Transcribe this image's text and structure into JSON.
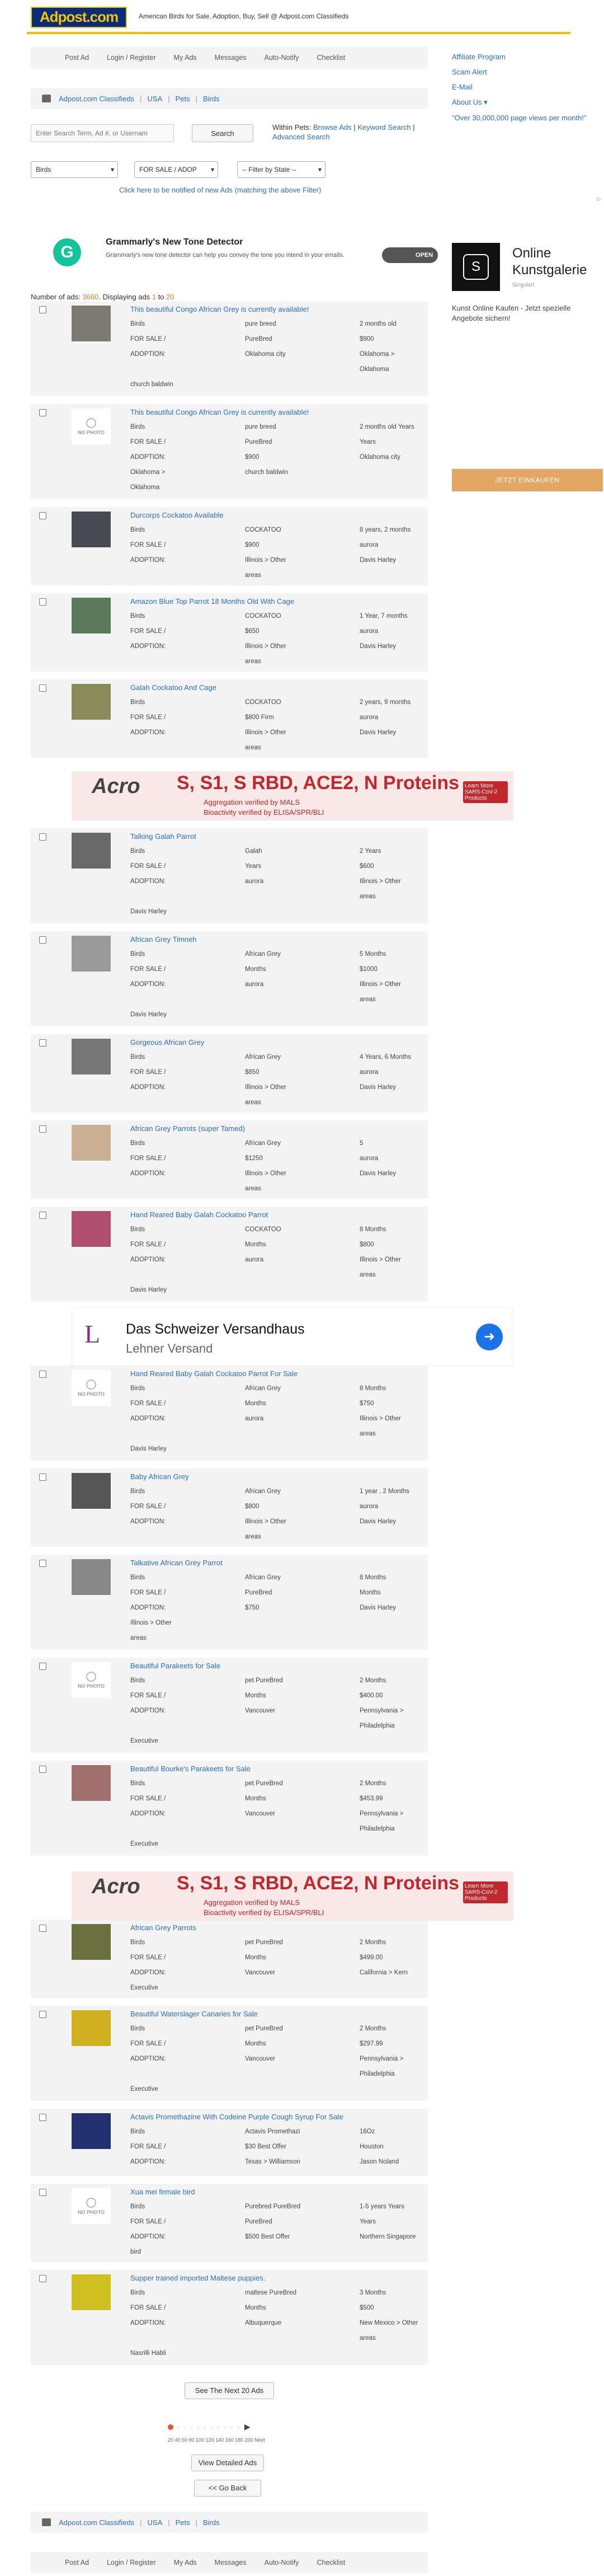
{
  "header": {
    "logo": "Adpost.com",
    "tagline": "American Birds for Sale, Adoption, Buy, Sell @ Adpost.com Classifieds"
  },
  "nav": [
    "Post Ad",
    "Login / Register",
    "My Ads",
    "Messages",
    "Auto-Notify",
    "Checklist"
  ],
  "breadcrumb": [
    "Adpost.com Classifieds",
    "USA",
    "Pets",
    "Birds"
  ],
  "search": {
    "placeholder": "Enter Search Term, Ad #, or Usernam",
    "button": "Search",
    "within_label": "Within Pets:",
    "browse": "Browse Ads",
    "keyword": "Keyword Search",
    "advanced": "Advanced Search"
  },
  "filters": {
    "category": "Birds",
    "type": "FOR SALE / ADOP",
    "state": "-- Filter by State --"
  },
  "notify_text": "Click here to be notified of new Ads (matching the above Filter)",
  "sidebar": {
    "links": [
      "Affiliate Program",
      "Scam Alert",
      "E-Mail",
      "About Us"
    ],
    "quote": "\"Over 30,000,000 page views per month!\""
  },
  "grammarly": {
    "title": "Grammarly's New Tone Detector",
    "body": "Grammarly's new tone detector can help you convey the tone you intend in your emails.",
    "cta": "OPEN"
  },
  "galerie": {
    "title": "Online Kunstgalerie",
    "sub": "Singulart",
    "body": "Kunst Online Kaufen - Jetzt spezielle Angebote sichern!",
    "cta": "JETZT EINKAUFEN"
  },
  "counts": {
    "label": "Number of ads:",
    "total": "3660",
    "displaying": ". Displaying ads",
    "from": "1",
    "to_word": "to",
    "to": "20"
  },
  "listings": [
    {
      "title": "This beautiful Congo African Grey is currently available!",
      "photo": true,
      "rows": [
        [
          "Birds",
          "pure breed",
          "2 months old"
        ],
        [
          "FOR SALE /",
          "PureBred",
          "$900"
        ],
        [
          "ADOPTION:",
          "Oklahoma city",
          "Oklahoma >"
        ],
        [
          "",
          "",
          "Oklahoma"
        ],
        [
          "church baldwin",
          "",
          ""
        ]
      ]
    },
    {
      "title": "This beautiful Congo African Grey is currently available!",
      "photo": false,
      "rows": [
        [
          "Birds",
          "pure breed",
          "2 months old Years"
        ],
        [
          "FOR SALE /",
          "PureBred",
          "Years"
        ],
        [
          "ADOPTION:",
          "$900",
          "Oklahoma city"
        ],
        [
          "Oklahoma >",
          "church baldwin",
          ""
        ],
        [
          "Oklahoma",
          "",
          ""
        ]
      ]
    },
    {
      "title": "Durcorps Cockatoo Available",
      "photo": true,
      "rows": [
        [
          "Birds",
          "COCKATOO",
          "8 years, 2 months"
        ],
        [
          "FOR SALE /",
          "$900",
          "aurora"
        ],
        [
          "ADOPTION:",
          "Illinois > Other",
          "Davis Harley"
        ],
        [
          "",
          "areas",
          ""
        ]
      ]
    },
    {
      "title": "Amazon Blue Top Parrot 18 Months Old With Cage",
      "photo": true,
      "rows": [
        [
          "Birds",
          "COCKATOO",
          "1 Year, 7 months"
        ],
        [
          "FOR SALE /",
          "$650",
          "aurora"
        ],
        [
          "ADOPTION:",
          "Illinois > Other",
          "Davis Harley"
        ],
        [
          "",
          "areas",
          ""
        ]
      ]
    },
    {
      "title": "Galah Cockatoo And Cage",
      "photo": true,
      "rows": [
        [
          "Birds",
          "COCKATOO",
          "2 years, 9 months"
        ],
        [
          "FOR SALE /",
          "$800 Firm",
          "aurora"
        ],
        [
          "ADOPTION:",
          "Illinois > Other",
          "Davis Harley"
        ],
        [
          "",
          "areas",
          ""
        ]
      ]
    },
    {
      "title": "Talking Galah Parrot",
      "photo": true,
      "rows": [
        [
          "Birds",
          "Galah",
          "2 Years"
        ],
        [
          "FOR SALE /",
          "Years",
          "$600"
        ],
        [
          "ADOPTION:",
          "aurora",
          "Illinois > Other"
        ],
        [
          "",
          "",
          "areas"
        ],
        [
          "Davis Harley",
          "",
          ""
        ]
      ]
    },
    {
      "title": "African Grey Timneh",
      "photo": true,
      "rows": [
        [
          "Birds",
          "African Grey",
          "5 Months"
        ],
        [
          "FOR SALE /",
          "Months",
          "$1000"
        ],
        [
          "ADOPTION:",
          "aurora",
          "Illinois > Other"
        ],
        [
          "",
          "",
          "areas"
        ],
        [
          "Davis Harley",
          "",
          ""
        ]
      ]
    },
    {
      "title": "Gorgeous African Grey",
      "photo": true,
      "rows": [
        [
          "Birds",
          "African Grey",
          "4 Years, 6 Months"
        ],
        [
          "FOR SALE /",
          "$850",
          "aurora"
        ],
        [
          "ADOPTION:",
          "Illinois > Other",
          "Davis Harley"
        ],
        [
          "",
          "areas",
          ""
        ]
      ]
    },
    {
      "title": "African Grey Parrots (super Tamed)",
      "photo": true,
      "rows": [
        [
          "Birds",
          "African Grey",
          "5"
        ],
        [
          "FOR SALE /",
          "$1250",
          "aurora"
        ],
        [
          "ADOPTION:",
          "Illinois > Other",
          "Davis Harley"
        ],
        [
          "",
          "areas",
          ""
        ]
      ]
    },
    {
      "title": "Hand Reared Baby Galah Cockatoo Parrot",
      "photo": true,
      "rows": [
        [
          "Birds",
          "COCKATOO",
          "8 Months"
        ],
        [
          "FOR SALE /",
          "Months",
          "$800"
        ],
        [
          "ADOPTION:",
          "aurora",
          "Illinois > Other"
        ],
        [
          "",
          "",
          "areas"
        ],
        [
          "Davis Harley",
          "",
          ""
        ]
      ]
    },
    {
      "title": "Hand Reared Baby Galah Cockatoo Parrot For Sale",
      "photo": false,
      "rows": [
        [
          "Birds",
          "African Grey",
          "8 Months"
        ],
        [
          "FOR SALE /",
          "Months",
          "$750"
        ],
        [
          "ADOPTION:",
          "aurora",
          "Illinois > Other"
        ],
        [
          "",
          "",
          "areas"
        ],
        [
          "Davis Harley",
          "",
          ""
        ]
      ]
    },
    {
      "title": "Baby African Grey",
      "photo": true,
      "rows": [
        [
          "Birds",
          "African Grey",
          "1 year , 2 Months"
        ],
        [
          "FOR SALE /",
          "$800",
          "aurora"
        ],
        [
          "ADOPTION:",
          "Illinois > Other",
          "Davis Harley"
        ],
        [
          "",
          "areas",
          ""
        ]
      ]
    },
    {
      "title": "Talkative African Grey Parrot",
      "photo": true,
      "rows": [
        [
          "Birds",
          "African Grey",
          "8 Months"
        ],
        [
          "FOR SALE /",
          "PureBred",
          "Months"
        ],
        [
          "ADOPTION:",
          "$750",
          "Davis Harley"
        ],
        [
          "Illinois > Other",
          "",
          ""
        ],
        [
          "areas",
          "",
          ""
        ]
      ]
    },
    {
      "title": "Beautiful Parakeets for Sale",
      "photo": false,
      "rows": [
        [
          "Birds",
          "pet PureBred",
          "2 Months"
        ],
        [
          "FOR SALE /",
          "Months",
          "$400.00"
        ],
        [
          "ADOPTION:",
          "Vancouver",
          "Pennsylvania >"
        ],
        [
          "",
          "",
          "Philadelphia"
        ],
        [
          "Executive",
          "",
          ""
        ]
      ]
    },
    {
      "title": "Beautiful Bourke's Parakeets for Sale",
      "photo": true,
      "rows": [
        [
          "Birds",
          "pet PureBred",
          "2 Months"
        ],
        [
          "FOR SALE /",
          "Months",
          "$453.99"
        ],
        [
          "ADOPTION:",
          "Vancouver",
          "Pennsylvania >"
        ],
        [
          "",
          "",
          "Philadelphia"
        ],
        [
          "Executive",
          "",
          ""
        ]
      ]
    },
    {
      "title": "African Grey Parrots",
      "photo": true,
      "rows": [
        [
          "Birds",
          "pet PureBred",
          "2 Months"
        ],
        [
          "FOR SALE /",
          "Months",
          "$499.00"
        ],
        [
          "ADOPTION:",
          "Vancouver",
          "California > Kern"
        ],
        [
          "Executive",
          "",
          ""
        ]
      ]
    },
    {
      "title": "Beautiful Waterslager Canaries for Sale",
      "photo": true,
      "rows": [
        [
          "Birds",
          "pet PureBred",
          "2 Months"
        ],
        [
          "FOR SALE /",
          "Months",
          "$297.99"
        ],
        [
          "ADOPTION:",
          "Vancouver",
          "Pennsylvania >"
        ],
        [
          "",
          "",
          "Philadelphia"
        ],
        [
          "Executive",
          "",
          ""
        ]
      ]
    },
    {
      "title": "Actavis Promethazine With Codeine Purple Cough Syrup For Sale",
      "photo": true,
      "rows": [
        [
          "Birds",
          "Actavis Promethazi",
          "16Oz"
        ],
        [
          "FOR SALE /",
          "$30 Best Offer",
          "Houston"
        ],
        [
          "ADOPTION:",
          "Texas > Williamson",
          "Jason Noland"
        ]
      ]
    },
    {
      "title": "Xua mei female bird",
      "photo": false,
      "rows": [
        [
          "Birds",
          "Purebred PureBred",
          "1-5 years Years"
        ],
        [
          "FOR SALE /",
          "PureBred",
          "Years"
        ],
        [
          "ADOPTION:",
          "$500 Best Offer",
          "Northern Singapore"
        ],
        [
          "bird",
          "",
          ""
        ]
      ]
    },
    {
      "title": "Supper trained imported Maltese puppies.",
      "photo": true,
      "rows": [
        [
          "Birds",
          "maltese PureBred",
          "3 Months"
        ],
        [
          "FOR SALE /",
          "Months",
          "$500"
        ],
        [
          "ADOPTION:",
          "Albuquerque",
          "New Mexico > Other"
        ],
        [
          "",
          "",
          "areas"
        ],
        [
          "Nasrilli Habli",
          "",
          ""
        ]
      ]
    }
  ],
  "acro": {
    "brand": "Acro",
    "headline": "S, S1, S RBD, ACE2, N Proteins",
    "bullet1": "Aggregation verified by MALS",
    "bullet2": "Bioactivity verified by ELISA/SPR/BLI",
    "cta": "Learn More SARS-CoV-2 Products"
  },
  "swiss": {
    "title": "Das Schweizer Versandhaus",
    "sub": "Lehner Versand"
  },
  "next_button": "See The Next 20 Ads",
  "pager_labels": "20 40 60 80 100 120 140 160 180 200 Next",
  "detailed_button": "View Detailed Ads",
  "back_button": "<< Go Back",
  "colors": {
    "accent": "#f4c400",
    "link": "#2a6ebb",
    "bg_row": "#f4f4f4"
  }
}
